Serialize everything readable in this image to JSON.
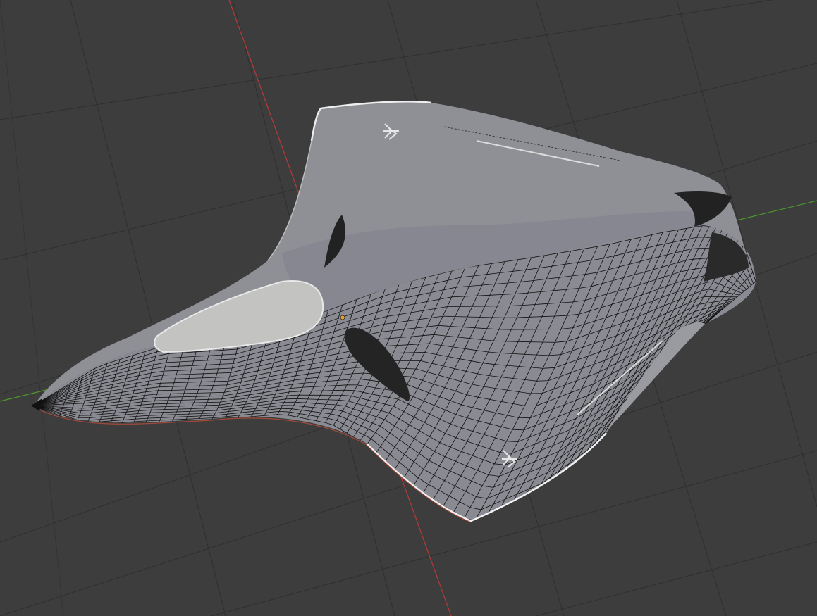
{
  "viewport": {
    "background": "#3d3d3d",
    "grid_color": "#2e2e2e",
    "x_axis_color": "#b83a3a",
    "y_axis_color": "#4c9a2a"
  },
  "mesh": {
    "surface_color": "#909197",
    "surface_dark": "#6f7076",
    "highlight_color": "#c2c2c0",
    "wire_color": "#111111",
    "edge_highlight": "#f0f0f0",
    "origin_dot_color": "#e3a03a",
    "cutout_color": "#222222"
  }
}
